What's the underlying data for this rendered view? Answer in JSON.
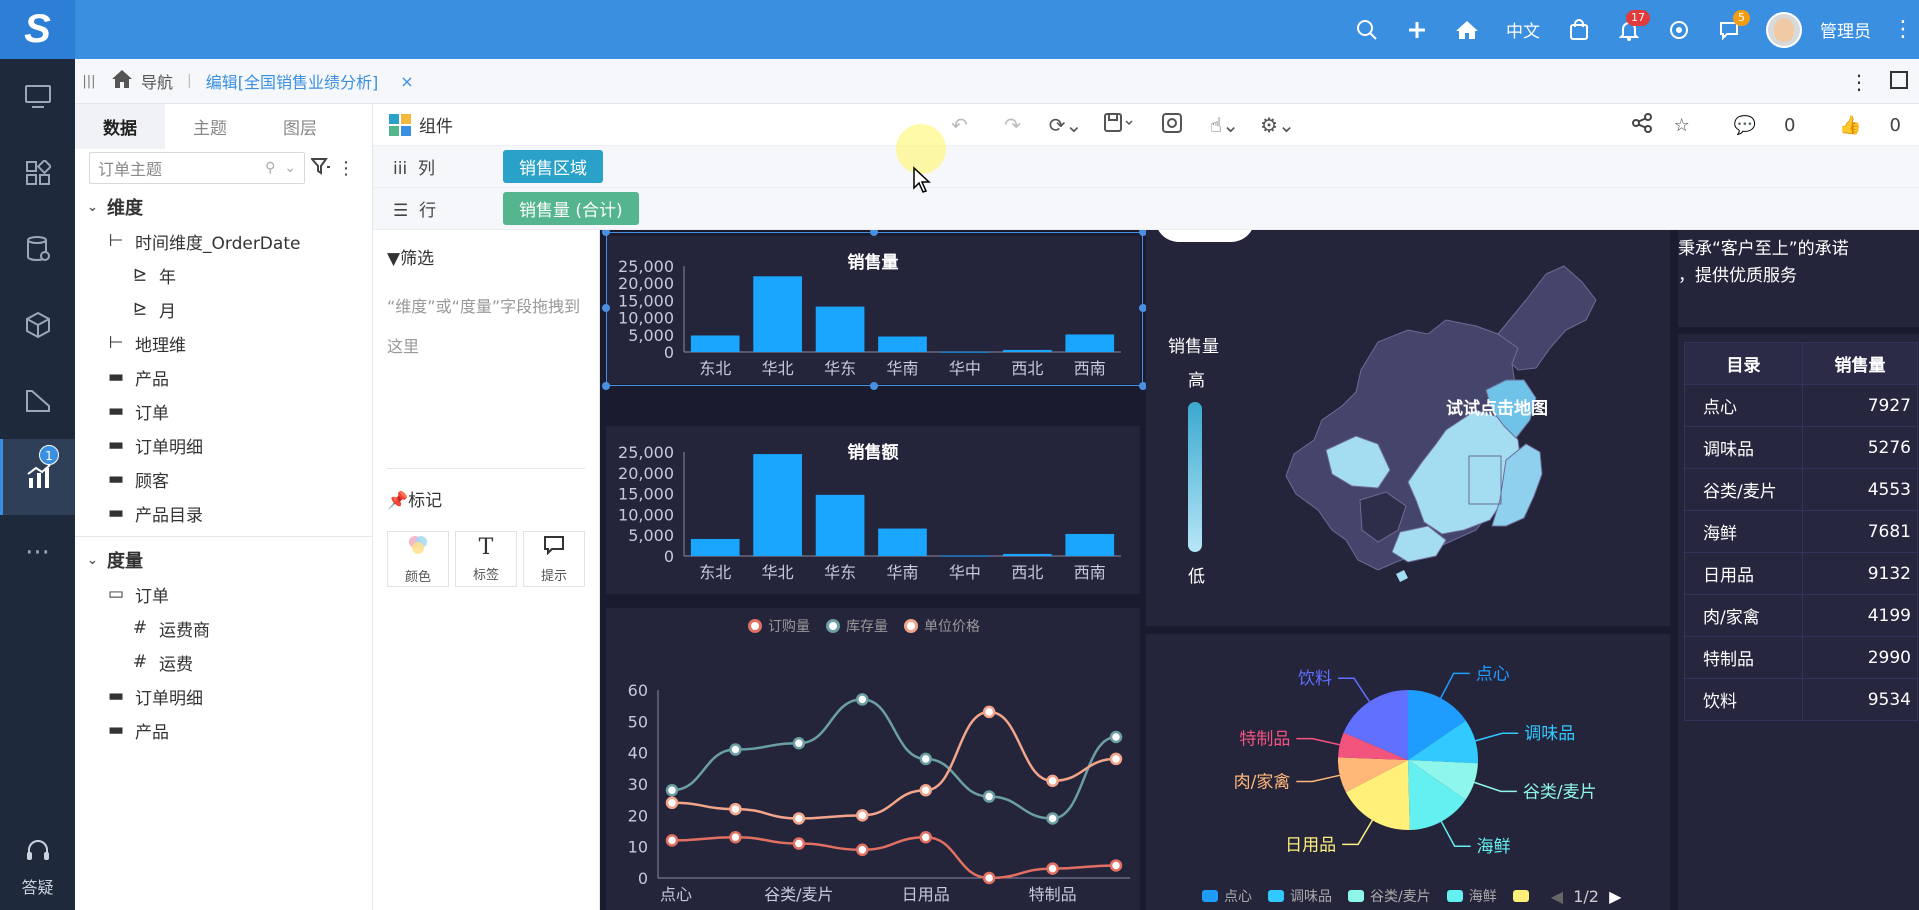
{
  "top": {
    "logo": "S",
    "lang": "中文",
    "bell_count": "17",
    "chat_count": "5",
    "user": "管理员",
    "icons": [
      "search-icon",
      "plus-icon",
      "home-icon",
      "bag-icon",
      "bell-icon",
      "robot-icon",
      "chat-icon"
    ]
  },
  "rail": {
    "badge": "1",
    "help": "答疑"
  },
  "tabs": {
    "home_label": "导航",
    "active_label": "编辑[全国销售业绩分析]",
    "close": "×"
  },
  "datapanel": {
    "tabs": [
      "数据",
      "主题",
      "图层"
    ],
    "search_placeholder": "订单主题",
    "dimension_group": "维度",
    "dimensions": [
      {
        "label": "时间维度_OrderDate",
        "icon": "hierarchy-icon",
        "level": 1
      },
      {
        "label": "年",
        "icon": "level-icon",
        "level": 2
      },
      {
        "label": "月",
        "icon": "level-icon",
        "level": 2
      },
      {
        "label": "地理维",
        "icon": "hierarchy-icon",
        "level": 1
      },
      {
        "label": "产品",
        "icon": "folder-icon",
        "level": 1
      },
      {
        "label": "订单",
        "icon": "folder-icon",
        "level": 1
      },
      {
        "label": "订单明细",
        "icon": "folder-icon",
        "level": 1
      },
      {
        "label": "顾客",
        "icon": "folder-icon",
        "level": 1
      },
      {
        "label": "产品目录",
        "icon": "folder-icon",
        "level": 1
      }
    ],
    "measure_group": "度量",
    "measures": [
      {
        "label": "订单",
        "icon": "folder-open-icon",
        "level": 1
      },
      {
        "label": "运费商",
        "icon": "hash-icon",
        "level": 2
      },
      {
        "label": "运费",
        "icon": "hash-icon",
        "level": 2
      },
      {
        "label": "订单明细",
        "icon": "folder-icon",
        "level": 1
      },
      {
        "label": "产品",
        "icon": "folder-icon",
        "level": 1
      }
    ]
  },
  "toolbar": {
    "component": "组件",
    "comments": "0",
    "likes": "0"
  },
  "shelves": {
    "col_label": "列",
    "col_pill": "销售区域",
    "row_label": "行",
    "row_pill": "销售量 (合计)"
  },
  "marks": {
    "filter_title": "筛选",
    "filter_hint": "“维度”或“度量”字段拖拽到这里",
    "marks_title": "标记",
    "buttons": [
      "颜色",
      "标签",
      "提示"
    ]
  },
  "colors": {
    "accent": "#3a8fe0",
    "bar": "#1aa6ff",
    "pill_col": "#2aa1c9",
    "pill_row": "#55b58f"
  },
  "chart_data": [
    {
      "type": "bar",
      "title": "销售量",
      "categories": [
        "东北",
        "华北",
        "华东",
        "华南",
        "华中",
        "西北",
        "西南"
      ],
      "values": [
        4800,
        22000,
        13200,
        4500,
        100,
        600,
        5100
      ],
      "ylim": [
        0,
        25000
      ],
      "yticks": [
        "0",
        "5,000",
        "10,000",
        "15,000",
        "20,000",
        "25,000"
      ]
    },
    {
      "type": "bar",
      "title": "销售额",
      "categories": [
        "东北",
        "华北",
        "华东",
        "华南",
        "华中",
        "西北",
        "西南"
      ],
      "values": [
        4100,
        24500,
        14700,
        6600,
        100,
        500,
        5300
      ],
      "ylim": [
        0,
        25000
      ],
      "yticks": [
        "0",
        "5,000",
        "10,000",
        "15,000",
        "20,000",
        "25,000"
      ]
    },
    {
      "type": "line",
      "categories": [
        "点心",
        "调味品",
        "谷类/麦片",
        "海鲜",
        "日用品",
        "肉/家禽",
        "特制品",
        "饮料"
      ],
      "xticks": [
        "点心",
        "谷类/麦片",
        "日用品",
        "特制品"
      ],
      "ylim": [
        0,
        60
      ],
      "yticks": [
        "0",
        "10",
        "20",
        "30",
        "40",
        "50",
        "60"
      ],
      "series": [
        {
          "name": "订购量",
          "color": "#e27062",
          "values": [
            12,
            13,
            11,
            9,
            13,
            0,
            3,
            4
          ]
        },
        {
          "name": "库存量",
          "color": "#6b9fa2",
          "values": [
            28,
            41,
            43,
            57,
            38,
            26,
            19,
            45
          ]
        },
        {
          "name": "单位价格",
          "color": "#f2a58a",
          "values": [
            24,
            22,
            19,
            20,
            28,
            53,
            31,
            38
          ]
        }
      ]
    },
    {
      "type": "pie",
      "categories": [
        "点心",
        "调味品",
        "谷类/麦片",
        "海鲜",
        "日用品",
        "肉/家禽",
        "特制品",
        "饮料"
      ],
      "values": [
        7927,
        5276,
        4553,
        7681,
        9132,
        4199,
        2990,
        9534
      ],
      "colors": [
        "#1f9dff",
        "#31c9ff",
        "#8ef6ea",
        "#64f0f0",
        "#fff07a",
        "#ffb877",
        "#f2547d",
        "#6170ff"
      ],
      "legend_page": "1/2"
    }
  ],
  "map": {
    "legend_title": "销售量",
    "high": "高",
    "low": "低",
    "hint": "试试点击地图"
  },
  "slogan": [
    "秉承“客户至上”的承诺",
    "，提供优质服务"
  ],
  "table": {
    "headers": [
      "目录",
      "销售量"
    ],
    "rows": [
      [
        "点心",
        "7927"
      ],
      [
        "调味品",
        "5276"
      ],
      [
        "谷类/麦片",
        "4553"
      ],
      [
        "海鲜",
        "7681"
      ],
      [
        "日用品",
        "9132"
      ],
      [
        "肉/家禽",
        "4199"
      ],
      [
        "特制品",
        "2990"
      ],
      [
        "饮料",
        "9534"
      ]
    ]
  }
}
